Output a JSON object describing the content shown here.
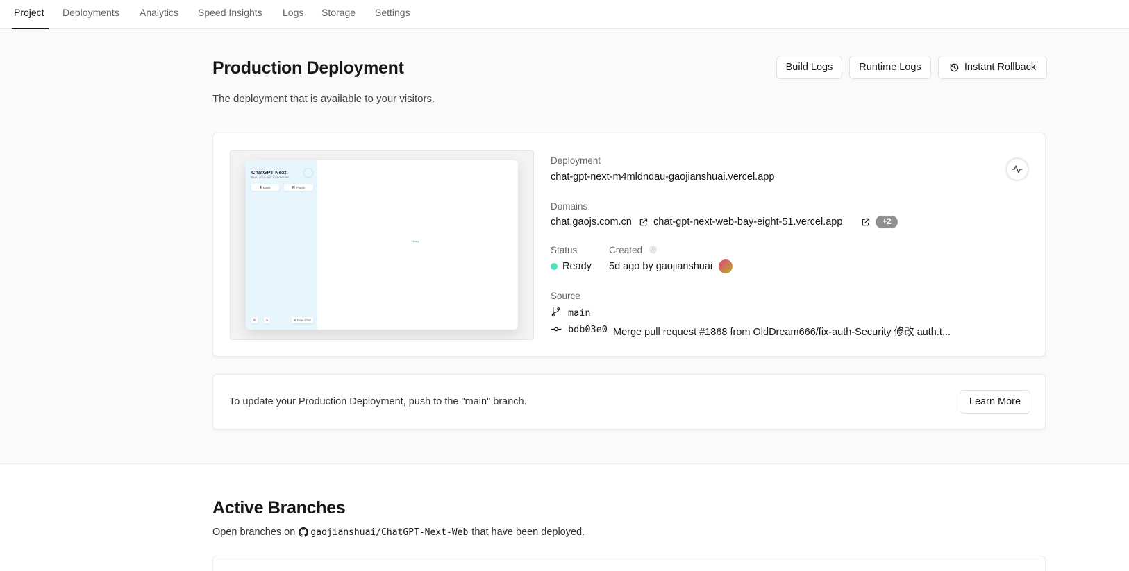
{
  "nav": {
    "tabs": [
      "Project",
      "Deployments",
      "Analytics",
      "Speed Insights",
      "Logs",
      "Storage",
      "Settings"
    ],
    "active": "Project"
  },
  "production": {
    "title": "Production Deployment",
    "subtitle": "The deployment that is available to your visitors.",
    "buttons": {
      "build_logs": "Build Logs",
      "runtime_logs": "Runtime Logs",
      "instant_rollback": "Instant Rollback"
    }
  },
  "preview": {
    "app_title": "ChatGPT Next",
    "app_subtitle": "Build your own AI assistant.",
    "mask_label": "Mask",
    "plugin_label": "Plugin",
    "new_chat_label": "New Chat",
    "loading": "···"
  },
  "deployment": {
    "deployment_label": "Deployment",
    "deployment_url": "chat-gpt-next-m4mldndau-gaojianshuai.vercel.app",
    "domains_label": "Domains",
    "domain_1": "chat.gaojs.com.cn",
    "domain_2": "chat-gpt-next-web-bay-eight-51.vercel.app",
    "domains_more": "+2",
    "status_label": "Status",
    "status_value": "Ready",
    "status_color": "#50e3c2",
    "created_label": "Created",
    "created_value": "5d ago by gaojianshuai",
    "source_label": "Source",
    "branch": "main",
    "commit_hash": "bdb03e0",
    "commit_message": "Merge pull request #1868 from OldDream666/fix-auth-Security 修改 auth.t..."
  },
  "notice": {
    "text": "To update your Production Deployment, push to the \"main\" branch.",
    "learn_more": "Learn More"
  },
  "branches": {
    "title": "Active Branches",
    "prefix": "Open branches on",
    "repo": "gaojianshuai/ChatGPT-Next-Web",
    "suffix": "that have been deployed."
  },
  "icons": {
    "rollback": "rollback-icon",
    "external": "external-link-icon",
    "info": "info-icon",
    "activity": "activity-icon",
    "branch": "git-branch-icon",
    "commit": "git-commit-icon",
    "github": "github-icon"
  }
}
